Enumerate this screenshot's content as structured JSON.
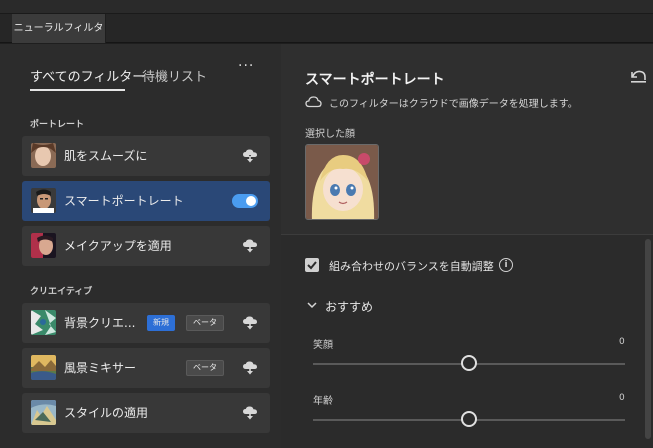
{
  "window": {
    "tab_title": "ニューラルフィルター"
  },
  "left": {
    "tabs": [
      {
        "label": "すべてのフィルター",
        "active": true
      },
      {
        "label": "待機リスト",
        "active": false
      }
    ],
    "more_label": "···",
    "sections": [
      {
        "label": "ポートレート",
        "items": [
          {
            "label": "肌をスムーズに",
            "state": "cloud"
          },
          {
            "label": "スマートポートレート",
            "state": "enabled"
          },
          {
            "label": "メイクアップを適用",
            "state": "cloud"
          }
        ]
      },
      {
        "label": "クリエイティブ",
        "items": [
          {
            "label": "背景クリエ...",
            "badges": [
              "新規",
              "ベータ"
            ],
            "state": "cloud"
          },
          {
            "label": "風景ミキサー",
            "badges": [
              "ベータ"
            ],
            "state": "cloud"
          },
          {
            "label": "スタイルの適用",
            "state": "cloud"
          }
        ]
      }
    ]
  },
  "right": {
    "title": "スマートポートレート",
    "cloud_note": "このフィルターはクラウドで画像データを処理します。",
    "selected_face_label": "選択した顔",
    "auto_balance_label": "組み合わせのバランスを自動調整",
    "auto_balance_checked": true,
    "recommended_label": "おすすめ",
    "sliders": [
      {
        "label": "笑顔",
        "value": "0",
        "fraction": 0.5
      },
      {
        "label": "年齢",
        "value": "0",
        "fraction": 0.5
      }
    ]
  },
  "colors": {
    "accent": "#4a9cf0",
    "selected_row": "#2a4877",
    "new_badge": "#2d6fd6"
  }
}
